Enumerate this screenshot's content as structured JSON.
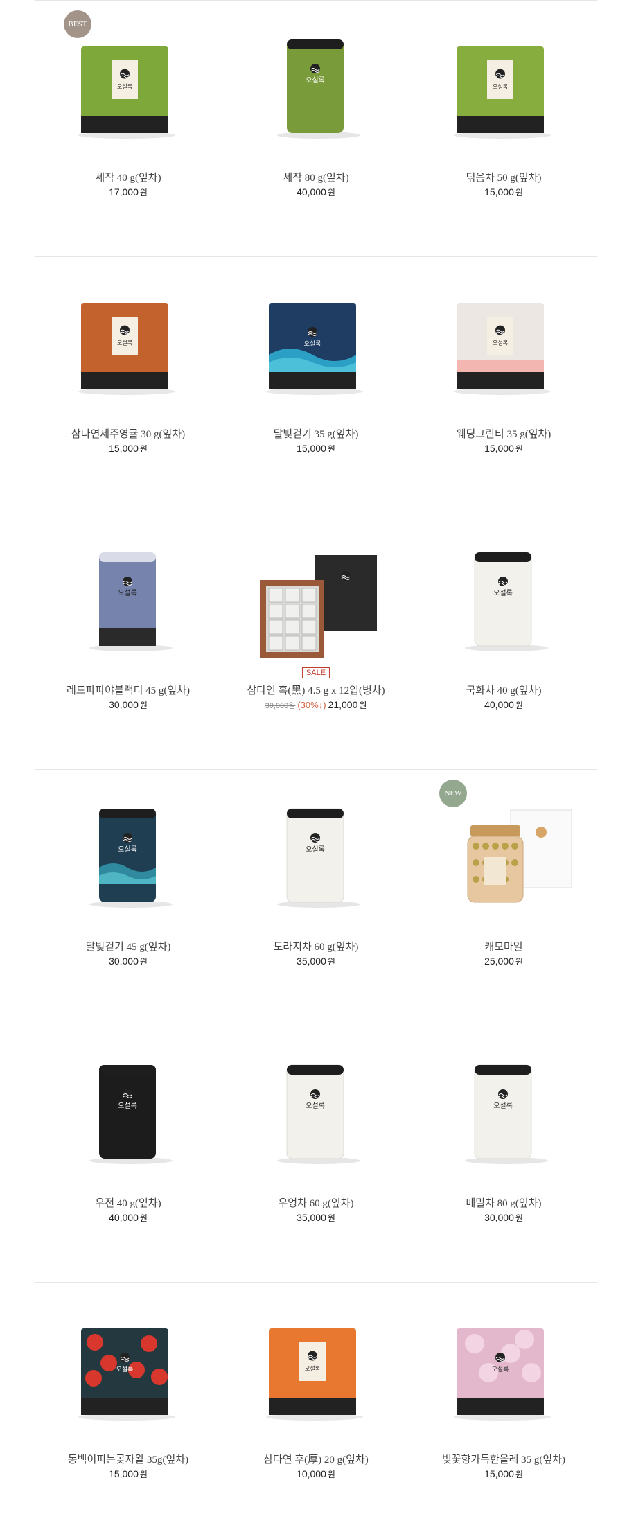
{
  "brand_label": "오설록",
  "currency": "원",
  "products": [
    {
      "name": "세작 40 g(잎차)",
      "price": "17,000",
      "badge": "BEST",
      "icon": "green-pouch-icon",
      "color": "#7fa83a"
    },
    {
      "name": "세작 80 g(잎차)",
      "price": "40,000",
      "icon": "green-tin-icon",
      "color": "#7a9b3a"
    },
    {
      "name": "덖음차 50 g(잎차)",
      "price": "15,000",
      "icon": "green-pouch-icon",
      "color": "#86ad3e"
    },
    {
      "name": "삼다연제주영귤 30 g(잎차)",
      "price": "15,000",
      "icon": "orange-pouch-icon",
      "color": "#c4622d"
    },
    {
      "name": "달빛걷기 35 g(잎차)",
      "price": "15,000",
      "icon": "blue-wave-pouch-icon",
      "color": "#1f3d63"
    },
    {
      "name": "웨딩그린티 35 g(잎차)",
      "price": "15,000",
      "icon": "white-pink-pouch-icon",
      "color": "#ece7e2"
    },
    {
      "name": "레드파파야블랙티 45 g(잎차)",
      "price": "30,000",
      "icon": "lavender-tin-icon",
      "color": "#7684ad"
    },
    {
      "name": "삼다연 흑(黑) 4.5 g x 12입(병차)",
      "price": "21,000",
      "original_price": "30,000원",
      "discount": "(30%↓)",
      "sale": "SALE",
      "icon": "gift-box-icon",
      "color": "#9a5a3a"
    },
    {
      "name": "국화차 40 g(잎차)",
      "price": "40,000",
      "icon": "white-tin-icon",
      "color": "#f2f1ec"
    },
    {
      "name": "달빛걷기 45 g(잎차)",
      "price": "30,000",
      "icon": "teal-tin-icon",
      "color": "#1f3e52"
    },
    {
      "name": "도라지차 60 g(잎차)",
      "price": "35,000",
      "icon": "white-tin-icon",
      "color": "#f2f1ec"
    },
    {
      "name": "캐모마일",
      "price": "25,000",
      "badge": "NEW",
      "icon": "glass-jar-icon",
      "color": "#e6c7a0"
    },
    {
      "name": "우전 40 g(잎차)",
      "price": "40,000",
      "icon": "black-tin-icon",
      "color": "#1c1c1c"
    },
    {
      "name": "우엉차 60 g(잎차)",
      "price": "35,000",
      "icon": "white-tin-icon",
      "color": "#f2f1ec"
    },
    {
      "name": "메밀차 80 g(잎차)",
      "price": "30,000",
      "icon": "white-tin-icon",
      "color": "#f2f1ec"
    },
    {
      "name": "동백이피는곶자왈 35g(잎차)",
      "price": "15,000",
      "icon": "camellia-pouch-icon",
      "color": "#24393f"
    },
    {
      "name": "삼다연 후(厚) 20 g(잎차)",
      "price": "10,000",
      "icon": "orange-pouch-icon",
      "color": "#e8772f"
    },
    {
      "name": "벚꽃향가득한올레 35 g(잎차)",
      "price": "15,000",
      "icon": "pink-floral-pouch-icon",
      "color": "#e4b8cc"
    }
  ]
}
